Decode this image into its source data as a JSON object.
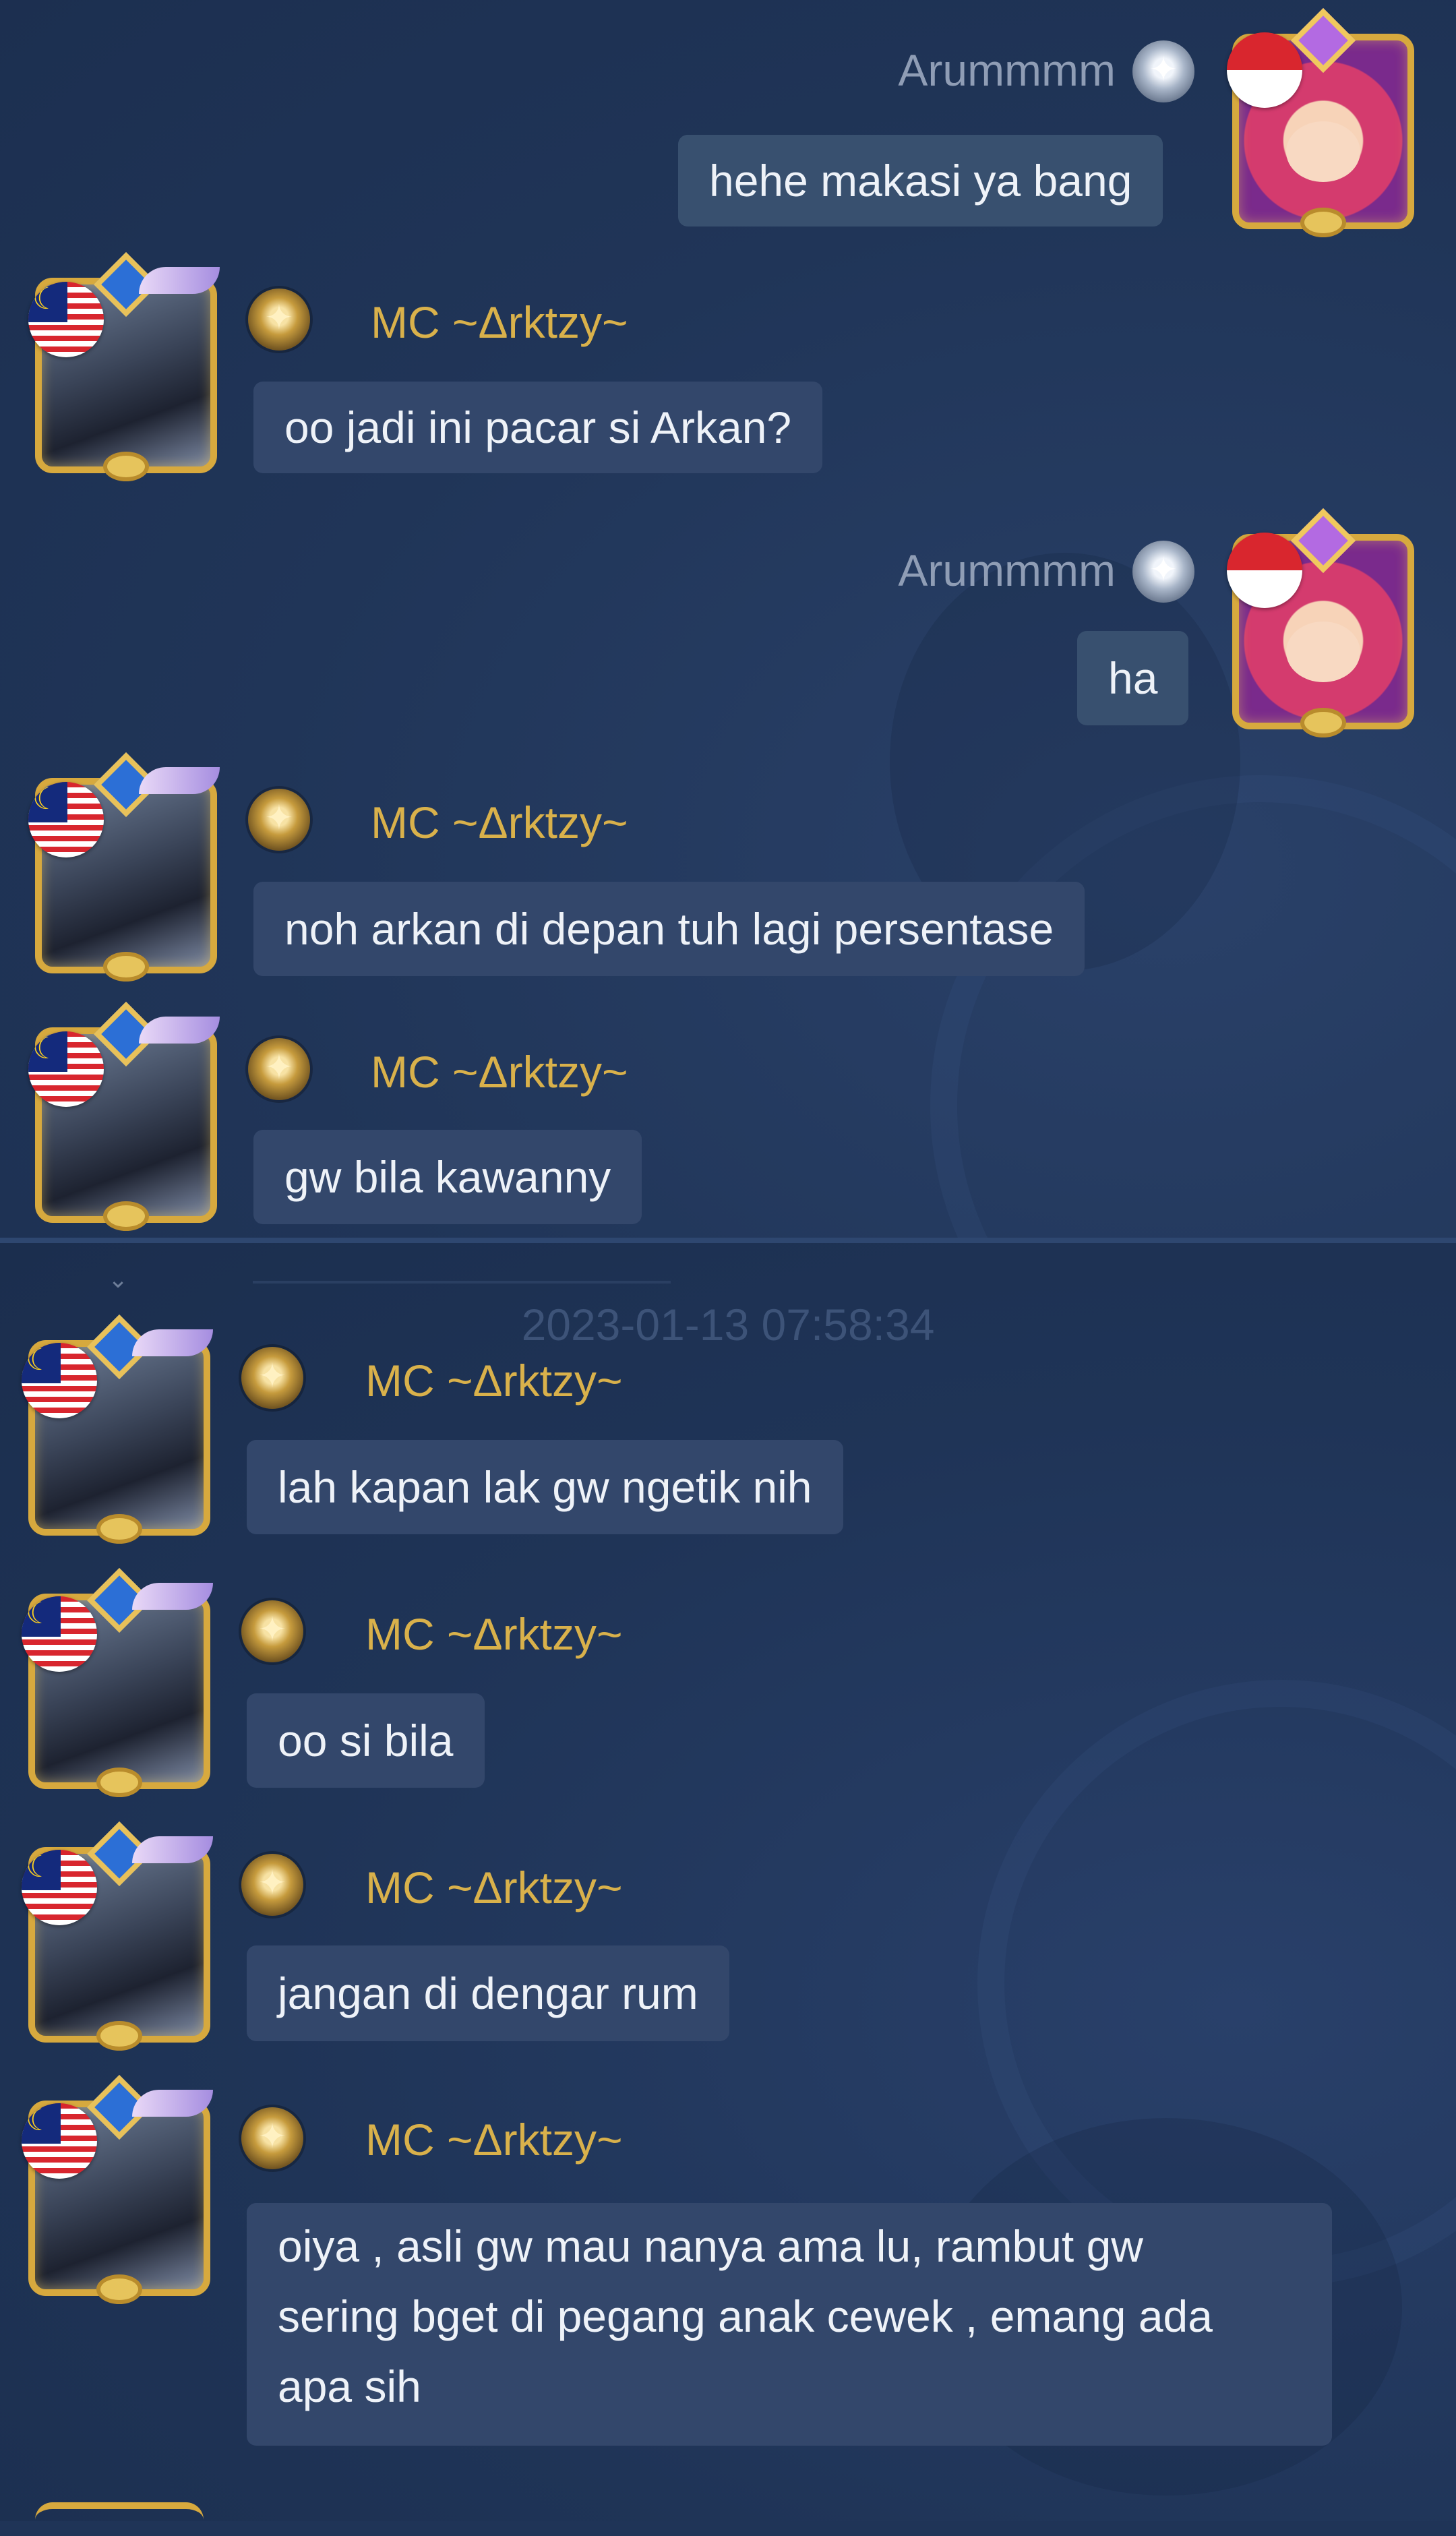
{
  "chat": {
    "divider_time": "2023-01-13 07:58:34",
    "messages": [
      {
        "sender": "Arummmm",
        "side": "right",
        "text": "hehe makasi ya bang",
        "flag": "id-flag-icon"
      },
      {
        "sender": "MC",
        "tag": "~Δrktzy~",
        "side": "left",
        "text": "oo jadi ini pacar si Arkan?",
        "flag": "my-flag-icon"
      },
      {
        "sender": "Arummmm",
        "side": "right",
        "text": "ha",
        "flag": "id-flag-icon"
      },
      {
        "sender": "MC",
        "tag": "~Δrktzy~",
        "side": "left",
        "text": "noh arkan di depan tuh lagi persentase",
        "flag": "my-flag-icon"
      },
      {
        "sender": "MC",
        "tag": "~Δrktzy~",
        "side": "left",
        "text": "gw bila kawanny",
        "flag": "my-flag-icon"
      },
      {
        "sender": "MC",
        "tag": "~Δrktzy~",
        "side": "left",
        "text": "lah kapan lak gw ngetik nih",
        "flag": "my-flag-icon"
      },
      {
        "sender": "MC",
        "tag": "~Δrktzy~",
        "side": "left",
        "text": "oo si bila",
        "flag": "my-flag-icon"
      },
      {
        "sender": "MC",
        "tag": "~Δrktzy~",
        "side": "left",
        "text": "jangan di dengar rum",
        "flag": "my-flag-icon"
      },
      {
        "sender": "MC",
        "tag": "~Δrktzy~",
        "side": "left",
        "text_lines": [
          "oiya , asli gw mau nanya ama lu, rambut gw",
          "sering bget di pegang anak cewek , emang ada",
          "apa sih"
        ],
        "flag": "my-flag-icon"
      }
    ]
  },
  "colors": {
    "background": "#1f3457",
    "bubble": "#33476b",
    "name_gold": "#d9b14b",
    "name_self": "#8f9db5",
    "text": "#eef2f8",
    "timestamp": "#3d5378"
  }
}
